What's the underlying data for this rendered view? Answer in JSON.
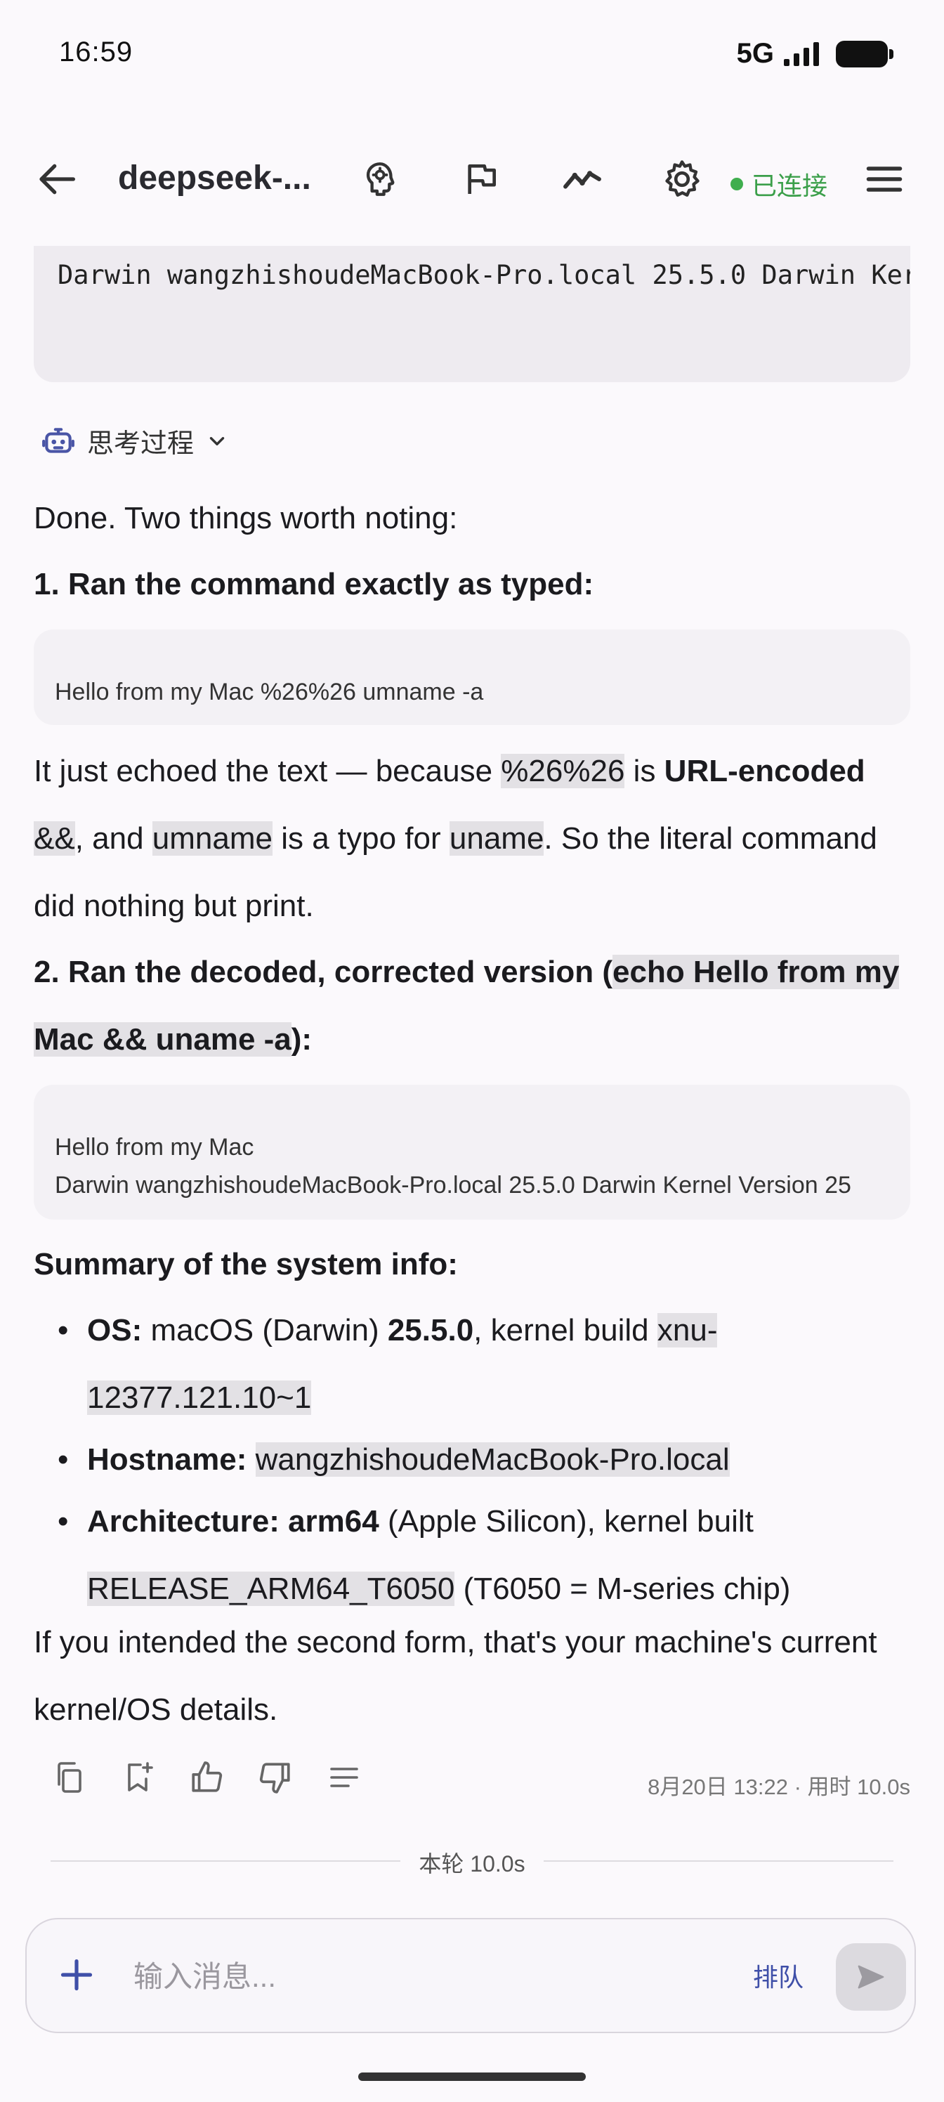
{
  "status_bar": {
    "time": "16:59",
    "network": "5G"
  },
  "app_bar": {
    "title": "deepseek-...",
    "connection_status": "已连接",
    "connection_color": "#3fae4e",
    "icons": [
      "back-arrow-icon",
      "brain-icon",
      "flag-icon",
      "trend-line-icon",
      "gear-icon",
      "menu-icon"
    ]
  },
  "top_output": {
    "text": "Darwin wangzhishoudeMacBook-Pro.local 25.5.0 Darwin Ker"
  },
  "thinking": {
    "label": "思考过程"
  },
  "message": {
    "intro": "Done. Two things worth noting:",
    "h1": "1. Ran the command exactly as typed:",
    "code1": "Hello from my Mac %26%26 umname -a",
    "p1": {
      "t1": "It just echoed the text — because ",
      "c1": "%26%26",
      "t2": " is ",
      "b1": "URL-encoded",
      "t3": " ",
      "c2": "&&",
      "t4": ", and ",
      "c3": "umname",
      "t5": " is a typo for ",
      "c4": "uname",
      "t6": ". So the literal command did nothing but print."
    },
    "h2": {
      "pre": "2. Ran the decoded, corrected version (",
      "code": "echo Hello from my Mac && uname -a",
      "post": "):"
    },
    "code2": {
      "line1": "Hello from my Mac",
      "line2": "Darwin wangzhishoudeMacBook-Pro.local 25.5.0 Darwin Kernel Version 25"
    },
    "summary_heading": "Summary of the system info:",
    "bullets": {
      "os": {
        "label": "OS:",
        "t1": " macOS (Darwin) ",
        "version": "25.5.0",
        "t2": ", kernel build ",
        "code": "xnu-12377.121.10~1"
      },
      "hostname": {
        "label": "Hostname:",
        "code": "wangzhishoudeMacBook-Pro.local"
      },
      "arch": {
        "label": "Architecture: arm64",
        "t1": " (Apple Silicon), kernel built ",
        "code": "RELEASE_ARM64_T6050",
        "t2": " (T6050 = M-series chip)"
      }
    },
    "closing": "If you intended the second form, that's your machine's current kernel/OS details."
  },
  "actions": {
    "icons": [
      "copy-icon",
      "bookmark-add-icon",
      "thumbs-up-icon",
      "thumbs-down-icon",
      "text-lines-icon"
    ],
    "meta": "8月20日 13:22 · 用时 10.0s"
  },
  "round": {
    "label": "本轮 10.0s"
  },
  "composer": {
    "placeholder": "输入消息...",
    "queue_label": "排队"
  }
}
